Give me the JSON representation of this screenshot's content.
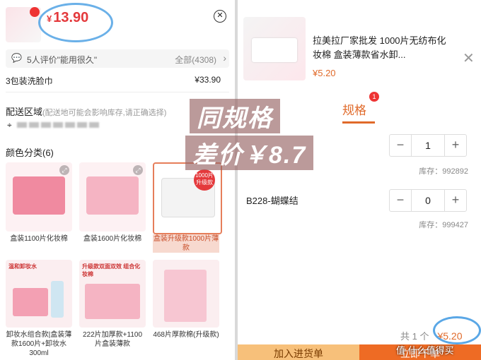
{
  "left": {
    "price_symbol": "¥",
    "price": "13.90",
    "review": {
      "text": "5人评价\"能用很久\"",
      "all": "全部(4308)"
    },
    "item_row": {
      "label": "3包装洗脸巾",
      "price": "¥33.90"
    },
    "shipping": {
      "title": "配送区域",
      "hint": "(配送地可能会影响库存,请正确选择)"
    },
    "color_title": "颜色分类(6)",
    "cards": [
      {
        "caption": "盒装1100片化妆棉"
      },
      {
        "caption": "盒装1600片化妆棉"
      },
      {
        "caption": "盒装升级款1000片薄款",
        "promo": "1000片 升级款"
      },
      {
        "caption": "卸妆水组合款|盒装薄款1600片+卸妆水300ml",
        "tag": "温和卸妆水"
      },
      {
        "caption": "222片加厚款+1100片盒装薄款",
        "tag": "升级款双面双效 组合化妆棉"
      },
      {
        "caption": "468片厚款棉(升级款)"
      }
    ]
  },
  "overlay": {
    "line1": "同规格",
    "line2": "差价￥8.7"
  },
  "right": {
    "title": "拉美拉厂家批发 1000片无纺布化妆棉 盒装薄款省水卸...",
    "price": "¥5.20",
    "tab": "规格",
    "tab_badge": "1",
    "rows": [
      {
        "name": "",
        "qty": "1",
        "stock": "库存：992892"
      },
      {
        "name": "B228-蝴蝶结",
        "qty": "0",
        "stock": "库存：999427"
      }
    ],
    "total_label": "共 1 个",
    "total_amount": "¥5.20",
    "add_button": "加入进货单",
    "order_button": "立即下单"
  },
  "watermark": "值 什么值得买"
}
